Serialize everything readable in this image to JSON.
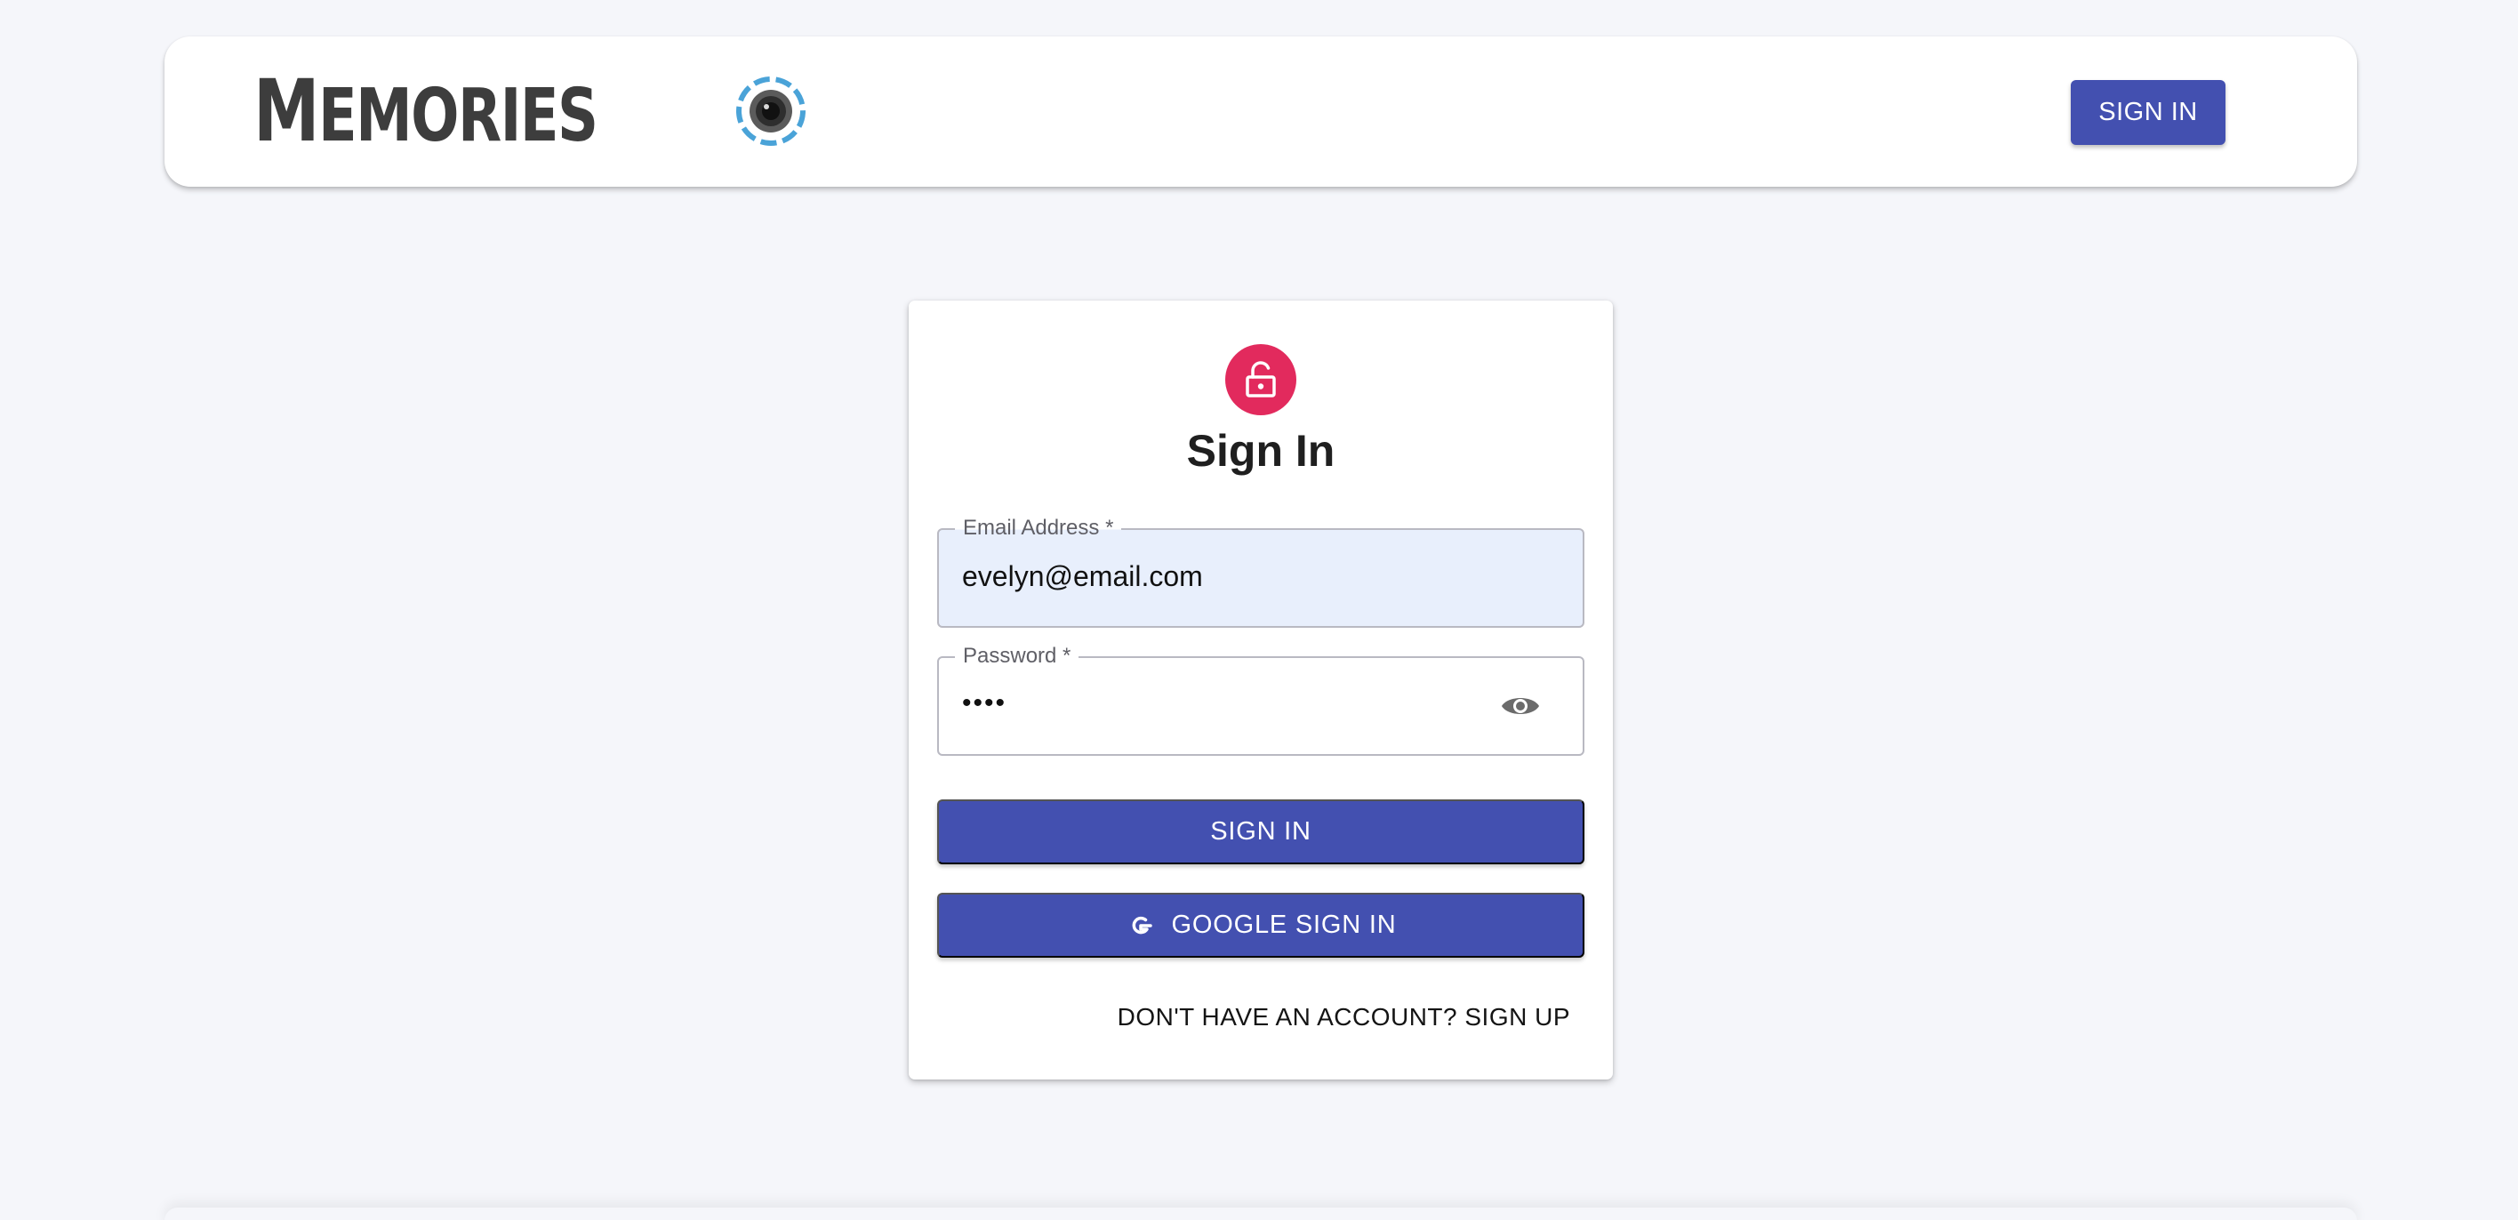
{
  "header": {
    "brand_first_letter": "M",
    "brand_rest": "EMORIES",
    "signin_label": "SIGN IN"
  },
  "card": {
    "title": "Sign In",
    "email": {
      "label": "Email Address *",
      "value": "evelyn@email.com"
    },
    "password": {
      "label": "Password *",
      "value": "••••"
    },
    "signin_label": "SIGN IN",
    "google_label": "GOOGLE SIGN IN",
    "signup_link": "DON'T HAVE AN ACCOUNT? SIGN UP"
  },
  "icons": {
    "avatar": "lock-open-icon",
    "password_toggle": "eye-icon",
    "google": "google-icon",
    "brand_logo": "camera-lens-icon"
  },
  "colors": {
    "primary": "#4350b0",
    "avatar_bg": "#e22a5d",
    "autofill_bg": "#e8effc",
    "logo_ring": "#4aa3d8"
  }
}
